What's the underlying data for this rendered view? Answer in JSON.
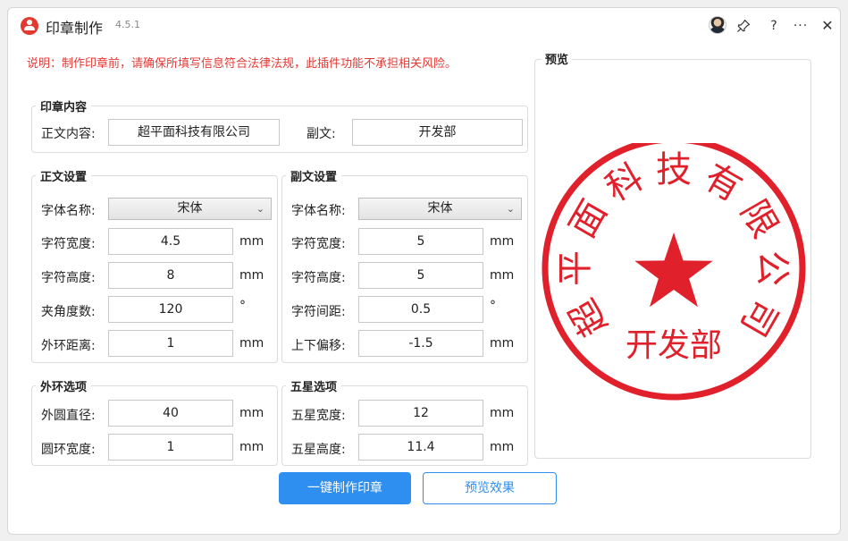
{
  "titlebar": {
    "title": "印章制作",
    "version": "4.5.1",
    "icons": [
      "user-avatar",
      "pin-icon",
      "help-icon",
      "more-icon",
      "close-icon"
    ],
    "help_label": "?",
    "more_label": "···",
    "close_label": "✕"
  },
  "notice": "说明：制作印章前，请确保所填写信息符合法律法规，此插件功能不承担相关风险。",
  "content_group": {
    "title": "印章内容",
    "main_label": "正文内容:",
    "main_value": "超平面科技有限公司",
    "sub_label": "副文:",
    "sub_value": "开发部"
  },
  "main_settings": {
    "title": "正文设置",
    "font_label": "字体名称:",
    "font_value": "宋体",
    "width_label": "字符宽度:",
    "width_value": "4.5",
    "width_unit": "mm",
    "height_label": "字符高度:",
    "height_value": "8",
    "height_unit": "mm",
    "angle_label": "夹角度数:",
    "angle_value": "120",
    "angle_unit": "°",
    "ring_dist_label": "外环距离:",
    "ring_dist_value": "1",
    "ring_dist_unit": "mm"
  },
  "sub_settings": {
    "title": "副文设置",
    "font_label": "字体名称:",
    "font_value": "宋体",
    "width_label": "字符宽度:",
    "width_value": "5",
    "width_unit": "mm",
    "height_label": "字符高度:",
    "height_value": "5",
    "height_unit": "mm",
    "spacing_label": "字符间距:",
    "spacing_value": "0.5",
    "spacing_unit": "°",
    "offset_label": "上下偏移:",
    "offset_value": "-1.5",
    "offset_unit": "mm"
  },
  "ring_options": {
    "title": "外环选项",
    "diameter_label": "外圆直径:",
    "diameter_value": "40",
    "diameter_unit": "mm",
    "ring_width_label": "圆环宽度:",
    "ring_width_value": "1",
    "ring_width_unit": "mm"
  },
  "star_options": {
    "title": "五星选项",
    "width_label": "五星宽度:",
    "width_value": "12",
    "width_unit": "mm",
    "height_label": "五星高度:",
    "height_value": "11.4",
    "height_unit": "mm"
  },
  "preview": {
    "title": "预览",
    "seal_arc_chars": [
      "超",
      "平",
      "面",
      "科",
      "技",
      "有",
      "限",
      "公",
      "司"
    ],
    "seal_bottom_text": "开发部",
    "seal_color": "#e0202a"
  },
  "actions": {
    "make_label": "一键制作印章",
    "preview_label": "预览效果"
  },
  "colors": {
    "accent": "#2f8ff0",
    "notice": "#e53935"
  }
}
